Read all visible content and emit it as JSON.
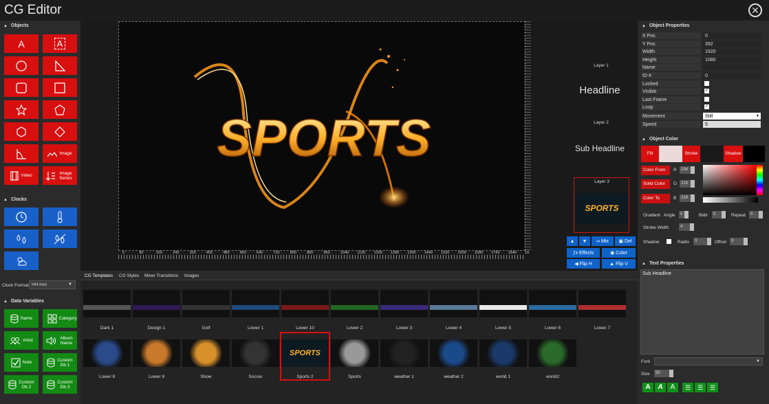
{
  "app": {
    "title": "CG Editor"
  },
  "sections": {
    "objects": "Objects",
    "clocks": "Clocks",
    "data_variables": "Data Variables",
    "object_properties": "Object Properties",
    "object_color": "Object Color",
    "text_properties": "Text Properties"
  },
  "objects_tools": {
    "text": "A",
    "image_label": "Image",
    "video_label": "Video",
    "image_series_label": "Image Series"
  },
  "clock_format": {
    "label": "Clock Format",
    "value": "HH:mm"
  },
  "data_variables": [
    "Name",
    "Category",
    "Artist",
    "Album Name",
    "Note",
    "Custom Db 1",
    "Custom Db 2",
    "Custom Db 3"
  ],
  "canvas": {
    "title_text": "SPORTS"
  },
  "ruler_ticks": [
    "0",
    "80",
    "160",
    "240",
    "320",
    "400",
    "480",
    "560",
    "640",
    "720",
    "800",
    "880",
    "960",
    "1040",
    "1120",
    "1200",
    "1280",
    "1360",
    "1440",
    "1520",
    "1600",
    "1680",
    "1760",
    "1840",
    "19"
  ],
  "layers": {
    "layer1_label": "Layer 1",
    "layer1_text": "Headline",
    "layer2_label": "Layer 2",
    "layer2_text": "Sub Headline",
    "layer3_label": "Layer 3",
    "layer3_thumb_text": "SPORTS"
  },
  "layer_actions": {
    "mix": "Mix",
    "del": "Del",
    "effects": "Effects",
    "color": "Color",
    "flip_h": "Flip H",
    "flip_v": "Flip V"
  },
  "tabs": [
    "CG Templates",
    "CG Styles",
    "Mixer Transitions",
    "Images"
  ],
  "templates_row1": [
    "Dark 1",
    "Design 1",
    "Golf",
    "Lower 1",
    "Lower 10",
    "Lower 2",
    "Lower 3",
    "Lower 4",
    "Lower 5",
    "Lower 6",
    "Lower 7"
  ],
  "templates_row2": [
    "Lower 8",
    "Lower 9",
    "Show",
    "Soccer",
    "Sports 2",
    "Sports",
    "weather 1",
    "weather 2",
    "world 1",
    "world2"
  ],
  "object_properties": [
    {
      "name": "X Pos",
      "value": "0"
    },
    {
      "name": "Y Pos",
      "value": "392"
    },
    {
      "name": "Width",
      "value": "1920"
    },
    {
      "name": "Height",
      "value": "1080"
    },
    {
      "name": "Name",
      "value": ""
    },
    {
      "name": "ID #",
      "value": "0"
    }
  ],
  "object_flags": [
    {
      "name": "Locked",
      "checked": false
    },
    {
      "name": "Visible",
      "checked": true
    },
    {
      "name": "Last Frame",
      "checked": false
    },
    {
      "name": "Loop",
      "checked": true
    }
  ],
  "movement": {
    "label": "Movement",
    "value": "Still"
  },
  "speed": {
    "label": "Speed",
    "value": "5"
  },
  "color": {
    "fill": "Fill",
    "stroke": "Stroke",
    "shadow": "Shadow",
    "color_from": "Color From",
    "solid_color": "Solid Color",
    "color_to": "Color To",
    "r_label": "R",
    "r_value": "234",
    "g_label": "G",
    "g_value": "219",
    "b_label": "B",
    "b_value": "219",
    "picker_value": "0",
    "gradient_label": "Gradient",
    "angle_label": "Angle",
    "angle_value": "0",
    "bidir_label": "Bidir",
    "bidir_value": "0",
    "repeat_label": "Repeat",
    "repeat_value": "0",
    "stroke_width_label": "Stroke Width",
    "stroke_width_value": "4",
    "shadow_label": "Shadow",
    "radio_label": "Radio",
    "radio_value": "3",
    "offset_label": "Offset",
    "offset_value": "3"
  },
  "text_properties": {
    "content": "Sub Headline",
    "font_label": "Font",
    "font_value": "",
    "size_label": "Size",
    "size_value": "50"
  },
  "colors": {
    "accent_red": "#d80f0f",
    "clock_blue": "#1860c8",
    "data_green": "#138a13",
    "action_blue": "#0f63c9"
  }
}
